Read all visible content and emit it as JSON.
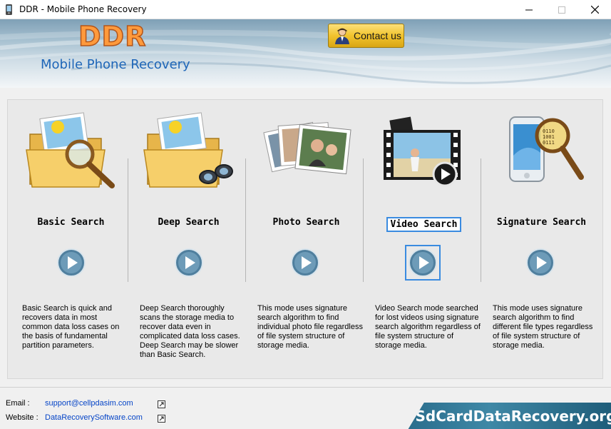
{
  "window": {
    "title": "DDR - Mobile Phone Recovery",
    "minimize_icon": "minimize-icon",
    "maximize_icon": "maximize-icon",
    "close_icon": "close-icon"
  },
  "banner": {
    "brand": "DDR",
    "subtitle": "Mobile Phone Recovery",
    "contact_label": "Contact us",
    "accent_color": "#ff9a3c"
  },
  "modes": [
    {
      "title": "Basic Search",
      "icon": "folder-magnifier-icon",
      "description": "Basic Search is quick and recovers data in most common data loss cases on the basis of fundamental partition parameters."
    },
    {
      "title": "Deep Search",
      "icon": "folder-binoculars-icon",
      "description": "Deep Search thoroughly scans the storage media to recover data even in complicated data loss cases. Deep Search may be slower than Basic Search."
    },
    {
      "title": "Photo Search",
      "icon": "photo-stack-icon",
      "description": "This mode uses signature search algorithm to find individual photo file regardless of file system structure of storage media."
    },
    {
      "title": "Video Search",
      "icon": "film-strip-icon",
      "description": "Video Search mode searched for lost videos using signature search algorithm regardless of file system structure of storage media.",
      "focused": true
    },
    {
      "title": "Signature Search",
      "icon": "phone-magnifier-icon",
      "description": "This mode uses signature search algorithm to find different file types regardless of file system structure of storage media."
    }
  ],
  "footer": {
    "email_label": "Email :",
    "email": "support@cellpdasim.com",
    "website_label": "Website :",
    "website": "DataRecoverySoftware.com",
    "brand_site": "SdCardDataRecovery.org"
  }
}
